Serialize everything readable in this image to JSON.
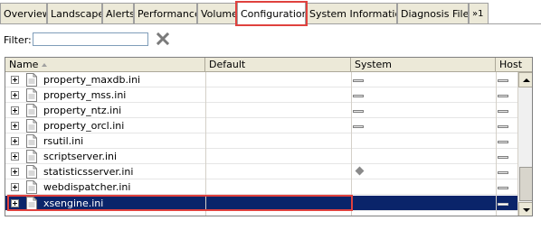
{
  "tabs": [
    {
      "label": "Overview",
      "active": false
    },
    {
      "label": "Landscape",
      "active": false
    },
    {
      "label": "Alerts",
      "active": false
    },
    {
      "label": "Performance",
      "active": false
    },
    {
      "label": "Volumes",
      "active": false
    },
    {
      "label": "Configuration",
      "active": true
    },
    {
      "label": "System Information",
      "active": false
    },
    {
      "label": "Diagnosis Files",
      "active": false
    }
  ],
  "tab_overflow": {
    "label": "»1"
  },
  "filter": {
    "label": "Filter:",
    "value": "",
    "placeholder": ""
  },
  "grid": {
    "columns": [
      "Name",
      "Default",
      "System",
      "Host"
    ],
    "rows": [
      {
        "name": "property_maxdb.ini",
        "system": "dash",
        "host": "dash",
        "selected": false
      },
      {
        "name": "property_mss.ini",
        "system": "dash",
        "host": "dash",
        "selected": false
      },
      {
        "name": "property_ntz.ini",
        "system": "dash",
        "host": "dash",
        "selected": false
      },
      {
        "name": "property_orcl.ini",
        "system": "dash",
        "host": "dash",
        "selected": false
      },
      {
        "name": "rsutil.ini",
        "system": "",
        "host": "dash",
        "selected": false
      },
      {
        "name": "scriptserver.ini",
        "system": "",
        "host": "dash",
        "selected": false
      },
      {
        "name": "statisticsserver.ini",
        "system": "diamond",
        "host": "dash",
        "selected": false
      },
      {
        "name": "webdispatcher.ini",
        "system": "",
        "host": "dash",
        "selected": false
      },
      {
        "name": "xsengine.ini",
        "system": "",
        "host": "dash",
        "selected": true
      }
    ]
  },
  "colors": {
    "selection": "#0a246a",
    "highlight_box": "#e0413e",
    "tab_bg": "#ece9d8"
  }
}
